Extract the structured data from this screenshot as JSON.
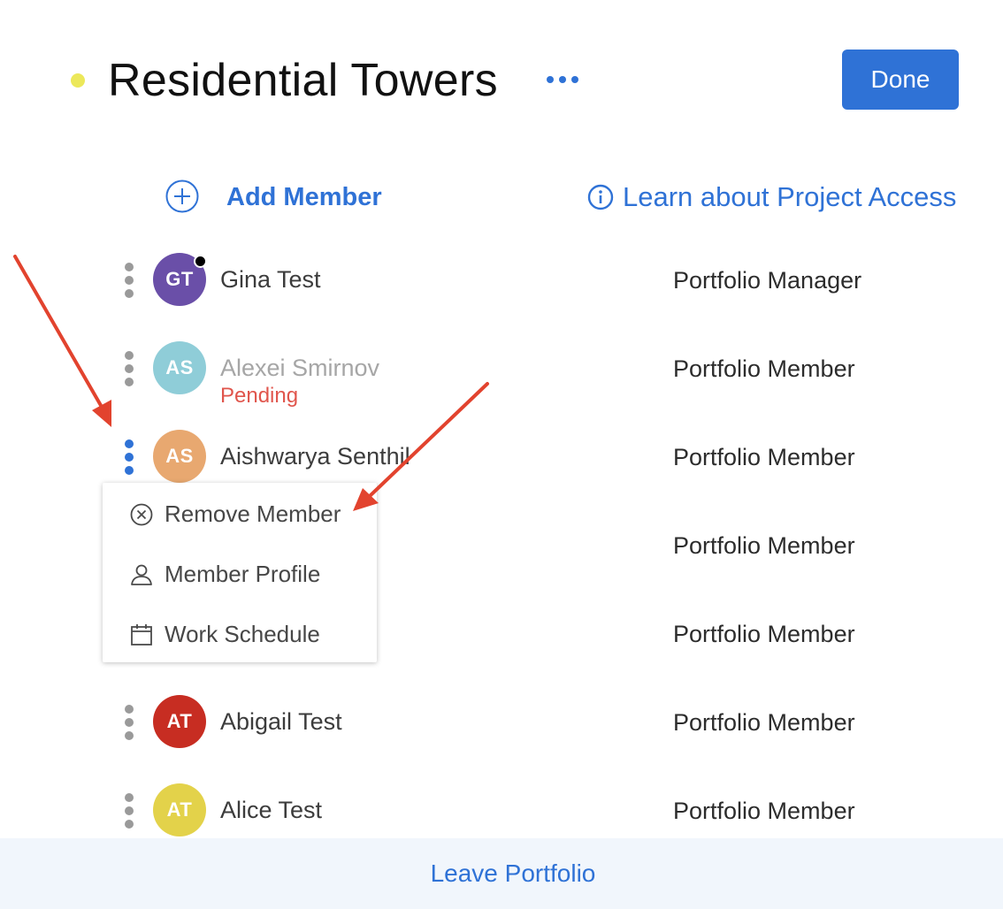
{
  "header": {
    "title": "Residential Towers",
    "status_color": "#ece85a",
    "more_icon": "more-horizontal-icon",
    "done_label": "Done"
  },
  "actions": {
    "add_member_label": "Add Member",
    "add_icon": "plus-circle-icon",
    "learn_label": "Learn about Project Access",
    "learn_icon": "info-circle-icon"
  },
  "members": [
    {
      "initials": "GT",
      "name": "Gina Test",
      "role": "Portfolio Manager",
      "color": "#6a4fa8",
      "online": true
    },
    {
      "initials": "AS",
      "name": "Alexei Smirnov",
      "status": "Pending",
      "role": "Portfolio Member",
      "color": "#8fcdd8"
    },
    {
      "initials": "AS",
      "name": "Aishwarya Senthil",
      "role": "Portfolio Member",
      "color": "#e8a870",
      "menu_open": true
    },
    {
      "initials": "",
      "name": "",
      "role": "Portfolio Member",
      "color": ""
    },
    {
      "initials": "",
      "name": "",
      "role": "Portfolio Member",
      "color": ""
    },
    {
      "initials": "AT",
      "name": "Abigail Test",
      "role": "Portfolio Member",
      "color": "#c72d22"
    },
    {
      "initials": "AT",
      "name": "Alice Test",
      "role": "Portfolio Member",
      "color": "#e3d24a"
    }
  ],
  "context_menu": {
    "items": [
      {
        "label": "Remove Member",
        "icon": "remove-circle-icon"
      },
      {
        "label": "Member Profile",
        "icon": "user-icon"
      },
      {
        "label": "Work Schedule",
        "icon": "calendar-icon"
      }
    ]
  },
  "annotations": {
    "arrow_color": "#e2432e"
  },
  "footer": {
    "leave_label": "Leave Portfolio"
  }
}
